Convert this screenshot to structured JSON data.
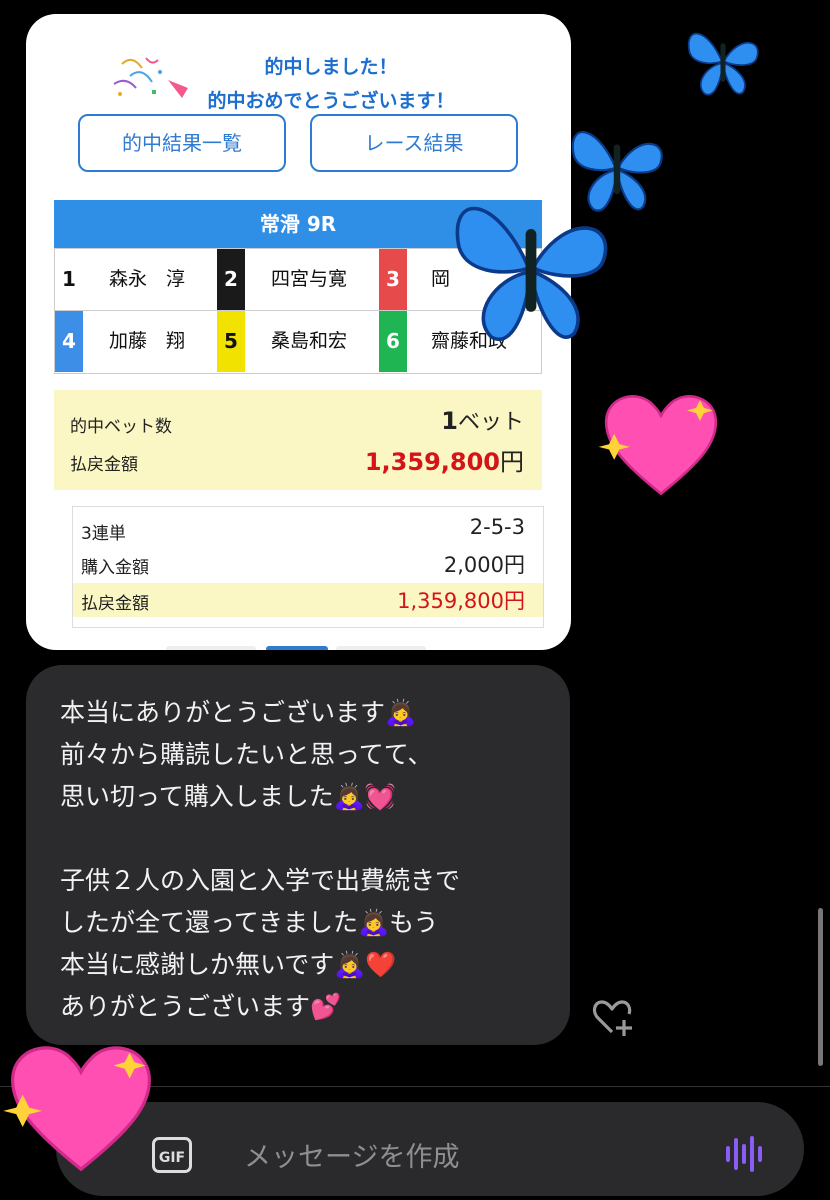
{
  "card": {
    "title_line1": "的中しました！",
    "title_line2": "的中おめでとうございます！",
    "button_results_list": "的中結果一覧",
    "button_race_result": "レース結果",
    "race_header": "常滑 9R",
    "racers": [
      {
        "num": "1",
        "name": "森永　淳",
        "num_color": "#ffffff",
        "num_text": "#111111"
      },
      {
        "num": "2",
        "name": "四宮与寛",
        "num_color": "#1a1a1a",
        "num_text": "#ffffff"
      },
      {
        "num": "3",
        "name": "岡",
        "num_color": "#e64a4a",
        "num_text": "#ffffff"
      },
      {
        "num": "4",
        "name": "加藤　翔",
        "num_color": "#3d8ee6",
        "num_text": "#ffffff"
      },
      {
        "num": "5",
        "name": "桑島和宏",
        "num_color": "#f2e200",
        "num_text": "#111111"
      },
      {
        "num": "6",
        "name": "齋藤和政",
        "num_color": "#1fb553",
        "num_text": "#ffffff"
      }
    ],
    "summary": {
      "bets_label": "的中ベット数",
      "bets_value_num": "1",
      "bets_value_unit": "ベット",
      "payout_label": "払戻金額",
      "payout_value": "1,359,800",
      "payout_unit": "円"
    },
    "detail": {
      "type_label": "3連単",
      "type_value": "2-5-3",
      "purchase_label": "購入金額",
      "purchase_value": "2,000円",
      "payout_label": "払戻金額",
      "payout_value": "1,359,800円"
    }
  },
  "message": {
    "lines": [
      "本当にありがとうございます🙇‍♀️",
      "前々から購読したいと思ってて、",
      "思い切って購入しました🙇‍♀️💓",
      "",
      "子供２人の入園と入学で出費続きで",
      "したが全て還ってきました🙇‍♀️もう",
      "本当に感謝しか無いです🙇‍♀️❤️",
      "ありがとうございます💕"
    ]
  },
  "input": {
    "gif_label": "GIF",
    "placeholder": "メッセージを作成"
  },
  "icons": {
    "react": "heart-plus-icon",
    "voice": "voice-wave-icon",
    "gif": "gif-icon"
  },
  "colors": {
    "accent_blue": "#2f7bd1",
    "payout_red": "#d4141a",
    "voice_purple": "#8a5cf6"
  }
}
